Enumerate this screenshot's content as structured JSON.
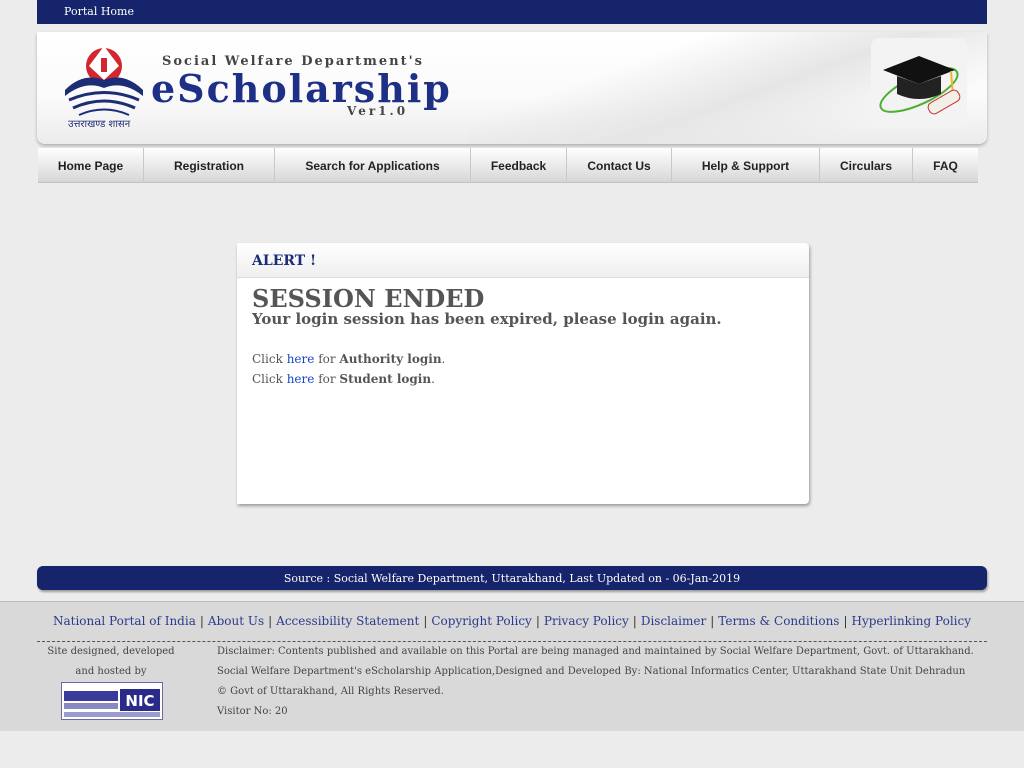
{
  "topbar": {
    "portal_home": "Portal Home"
  },
  "header": {
    "department": "Social Welfare Department's",
    "brand": "eScholarship",
    "version": "Ver1.0",
    "emblem_label": "उत्तराखण्ड शासन"
  },
  "nav": {
    "items": [
      {
        "label": "Home Page"
      },
      {
        "label": "Registration"
      },
      {
        "label": "Search for Applications"
      },
      {
        "label": "Feedback"
      },
      {
        "label": "Contact Us"
      },
      {
        "label": "Help & Support"
      },
      {
        "label": "Circulars"
      },
      {
        "label": "FAQ"
      }
    ]
  },
  "alert": {
    "title": "ALERT !",
    "heading": "SESSION ENDED",
    "message": "Your login session has been expired, please login again.",
    "authority": {
      "prefix": "Click",
      "link": "here",
      "mid": "for",
      "target": "Authority login",
      "suffix": "."
    },
    "student": {
      "prefix": "Click",
      "link": "here",
      "mid": "for",
      "target": "Student login",
      "suffix": "."
    }
  },
  "source": "Source : Social Welfare Department, Uttarakhand, Last Updated on - 06-Jan-2019",
  "footer": {
    "links": [
      "National Portal of India",
      "About Us",
      "Accessibility Statement",
      "Copyright Policy",
      "Privacy Policy",
      "Disclaimer",
      "Terms & Conditions",
      "Hyperlinking Policy"
    ],
    "separator": "|",
    "designed_line1": "Site designed, developed",
    "designed_line2": "and hosted by",
    "disclaimer": "Disclaimer: Contents published and available on this Portal are being managed and maintained by Social Welfare Department, Govt. of Uttarakhand.",
    "designed_by": "Social Welfare Department's eScholarship Application,Designed and Developed By: National Informatics Center, Uttarakhand State Unit Dehradun",
    "copyright": "© Govt of Uttarakhand, All Rights Reserved.",
    "visitor": "Visitor No: 20",
    "nic_logo_text": "NIC"
  },
  "colors": {
    "brand_navy": "#16246b",
    "link_blue": "#1847c6",
    "emblem_red": "#d22630"
  }
}
